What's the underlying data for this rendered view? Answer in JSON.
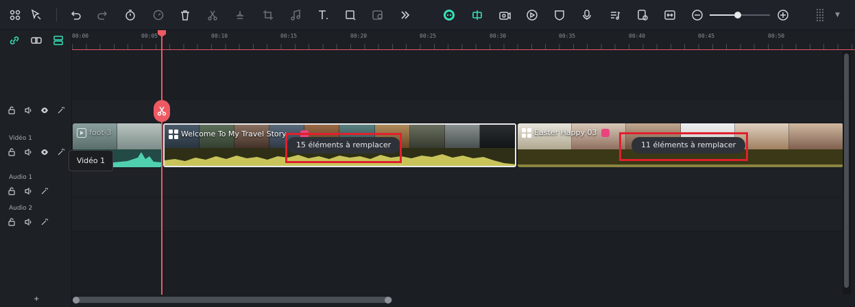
{
  "toolbar": {
    "icons": [
      "layout-icon",
      "select-tool-icon",
      "undo-icon",
      "redo-icon",
      "timer-icon",
      "speed-icon",
      "delete-icon",
      "cut-icon",
      "crop-split-icon",
      "crop-icon",
      "audio-icon",
      "text-icon",
      "shape-icon",
      "mask-icon",
      "more-icon",
      "ai-mate-icon",
      "split-screen-icon",
      "camera-icon",
      "play-circle-icon",
      "shield-icon",
      "microphone-icon",
      "music-list-icon",
      "image-cam-icon",
      "fit-icon",
      "zoom-out-icon",
      "zoom-in-icon"
    ],
    "zoom_level": 0.48
  },
  "ruler": {
    "labels": [
      "00:00",
      "00:05",
      "00:10",
      "00:15",
      "00:20",
      "00:25",
      "00:30",
      "00:35",
      "00:40",
      "00:45",
      "00:50"
    ]
  },
  "tracks": {
    "video1_label": "Vidéo 1",
    "audio1_label": "Audio 1",
    "audio2_label": "Audio 2",
    "add_track": "+"
  },
  "clips": {
    "clip_a_title": "foot-3",
    "clip_b_title": "Welcome To My Travel Story",
    "clip_c_title": "Easter Happy 03"
  },
  "badges": {
    "clip_b": "15 éléments à remplacer",
    "clip_c": "11 éléments à remplacer"
  },
  "tooltip": "Vidéo 1",
  "colors": {
    "accent": "#38e1b7",
    "playhead": "#ee5a63",
    "highlight": "#e0202c"
  }
}
